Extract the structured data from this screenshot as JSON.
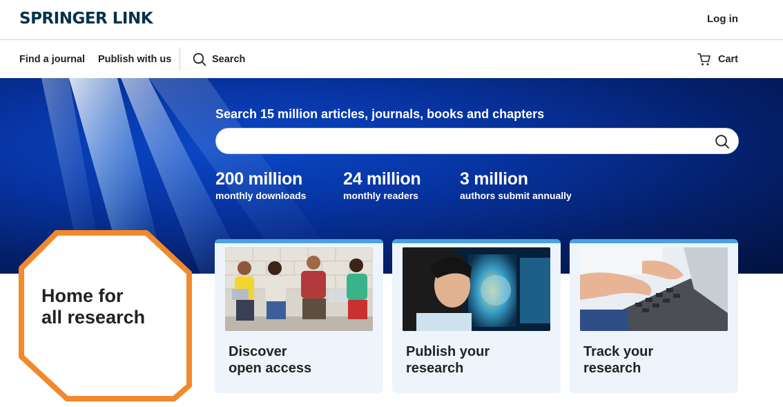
{
  "header": {
    "logo": "SPRINGER LINK",
    "login": "Log in"
  },
  "nav": {
    "find_journal": "Find a journal",
    "publish": "Publish with us",
    "search": "Search",
    "cart": "Cart"
  },
  "hero": {
    "title": "Search 15 million articles, journals, books and chapters",
    "search_value": "",
    "stats": [
      {
        "number": "200 million",
        "label": "monthly downloads"
      },
      {
        "number": "24 million",
        "label": "monthly readers"
      },
      {
        "number": "3 million",
        "label": "authors submit annually"
      }
    ]
  },
  "home": {
    "line1": "Home for",
    "line2": "all research"
  },
  "cards": [
    {
      "line1": "Discover",
      "line2": "open access"
    },
    {
      "line1": "Publish your",
      "line2": "research"
    },
    {
      "line1": "Track your",
      "line2": "research"
    }
  ],
  "colors": {
    "brand_dark": "#01324b",
    "accent_orange": "#f2892b",
    "card_bg": "#eef4fb",
    "card_border": "#4aa2e0"
  },
  "icons": {
    "nav_search": "search-icon",
    "hero_search": "search-icon",
    "cart": "cart-icon"
  }
}
